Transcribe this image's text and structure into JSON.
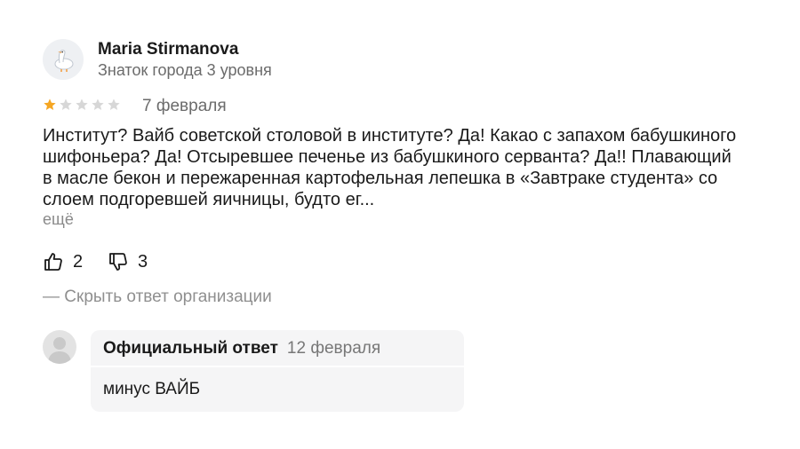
{
  "review": {
    "author_name": "Maria Stirmanova",
    "author_level": "Знаток города 3 уровня",
    "rating": 1,
    "rating_max": 5,
    "date": "7 февраля",
    "text": "Институт? Вайб советской столовой в институте? Да! Какао с запахом бабушкиного шифоньера? Да! Отсыревшее печенье из бабушкиного серванта? Да!! Плавающий в масле бекон и пережаренная картофельная лепешка в «Завтраке студента» со слоем подгоревшей яичницы, будто ег...",
    "more_label": "ещё"
  },
  "votes": {
    "likes": "2",
    "dislikes": "3"
  },
  "org_reply": {
    "toggle_label": "— Скрыть ответ организации",
    "label": "Официальный ответ",
    "date": "12 февраля",
    "text": "минус ВАЙБ"
  },
  "colors": {
    "star_filled": "#f5a623",
    "star_empty": "#d7d7d7",
    "card_bg": "#f5f5f6"
  },
  "icons": {
    "avatar": "goose-avatar-icon",
    "org_avatar": "person-silhouette-icon",
    "like": "thumbs-up-icon",
    "dislike": "thumbs-down-icon",
    "star": "star-icon"
  }
}
